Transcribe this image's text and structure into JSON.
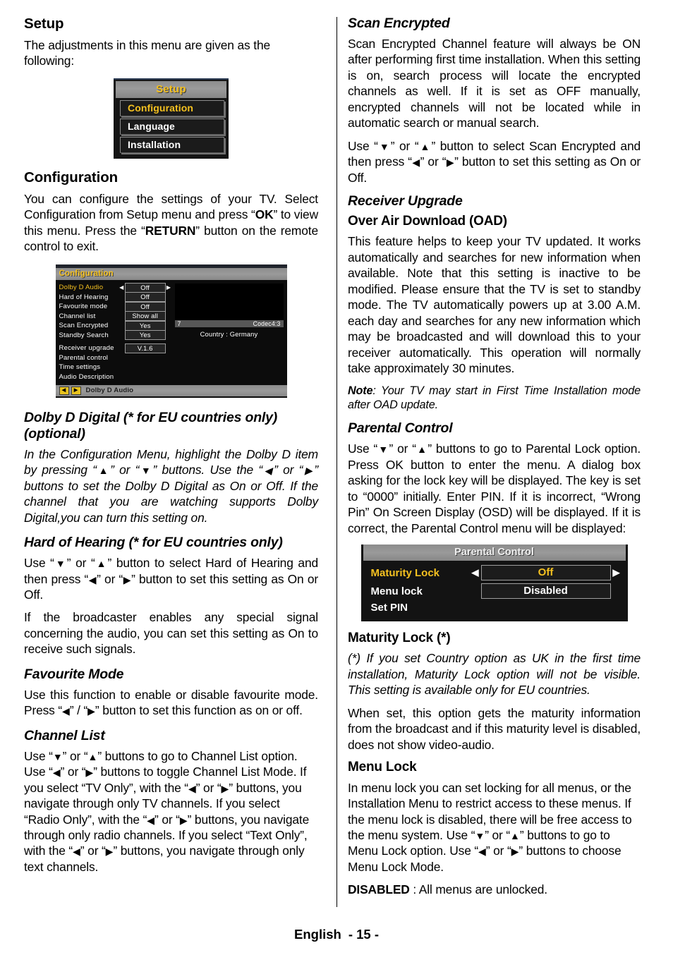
{
  "footer": {
    "language": "English",
    "page": "- 15 -"
  },
  "left": {
    "setup_heading": "Setup",
    "setup_intro": "The adjustments in this menu are given as the following:",
    "setup_osd": {
      "title": "Setup",
      "items": [
        {
          "label": "Configuration",
          "selected": true
        },
        {
          "label": "Language",
          "selected": false
        },
        {
          "label": "Installation",
          "selected": false
        }
      ]
    },
    "configuration_heading": "Configuration",
    "configuration_body_1": "You can configure the settings of your TV. Select Configuration from Setup menu and press “",
    "configuration_bold_ok": "OK",
    "configuration_body_2": "” to view this menu. Press the “",
    "configuration_bold_return": "RETURN",
    "configuration_body_3": "” button on the remote control to exit.",
    "config_osd": {
      "title": "Configuration",
      "rows": [
        {
          "label": "Dolby D Audio",
          "value": "Off",
          "selected": true,
          "carets": true
        },
        {
          "label": "Hard of Hearing",
          "value": "Off",
          "selected": false,
          "carets": false
        },
        {
          "label": "Favourite mode",
          "value": "Off",
          "selected": false,
          "carets": false
        },
        {
          "label": "Channel list",
          "value": "Show all",
          "selected": false,
          "carets": false
        },
        {
          "label": "Scan Encrypted",
          "value": "Yes",
          "selected": false,
          "carets": false
        },
        {
          "label": "Standby Search",
          "value": "Yes",
          "selected": false,
          "carets": false
        },
        {
          "label": "Receiver upgrade",
          "value": "V.1.6",
          "selected": false,
          "carets": false
        },
        {
          "label": "Parental control",
          "value": "",
          "selected": false,
          "carets": false
        },
        {
          "label": "Time settings",
          "value": "",
          "selected": false,
          "carets": false
        },
        {
          "label": "Audio Description",
          "value": "",
          "selected": false,
          "carets": false
        }
      ],
      "preview_bar_left": "7",
      "preview_bar_right": "Codec4:3",
      "country": "Country : Germany",
      "footer_left_key": "◀",
      "footer_right_key": "▶",
      "footer_text": "Dolby D Audio"
    },
    "dolby_heading": "Dolby D Digital (* for EU countries only) (optional)",
    "dolby_body_a": "In the Configuration Menu, highlight the Dolby D item by pressing “",
    "dolby_body_b": "” or “",
    "dolby_body_c": "” buttons. Use the “",
    "dolby_body_d": "” or “",
    "dolby_body_e": "” buttons to set the Dolby D Digital as On or Off. If the channel that you are watching supports Dolby Digital,you can turn this setting on.",
    "hoh_heading": "Hard of Hearing (* for EU countries only)",
    "hoh_body_a": "Use  “",
    "hoh_body_b": "” or “",
    "hoh_body_c": "” button to select Hard of Hearing and then press  “",
    "hoh_body_d": "” or “",
    "hoh_body_e": "” button to set this setting  as On or Off.",
    "hoh_body_2": "If the broadcaster enables any special signal concerning the audio, you can set this setting as On to receive such signals.",
    "fav_heading": "Favourite Mode",
    "fav_body_a": "Use this function to enable or disable favourite mode. Press “",
    "fav_body_b": "” / “",
    "fav_body_c": "” button to set this function as on or off.",
    "chlist_heading": "Channel List",
    "chlist_a": "Use “",
    "chlist_b": "” or “",
    "chlist_c": "” buttons to go to Channel List option. Use “",
    "chlist_d": "” or “",
    "chlist_e": "”  buttons to toggle Channel List Mode. If you select “TV Only”, with the “",
    "chlist_f": "” or “",
    "chlist_g": "”  buttons, you navigate through only TV channels. If you select “Radio Only”, with the “",
    "chlist_h": "” or “",
    "chlist_i": "”  buttons, you navigate through only radio channels.  If you select “Text Only”, with the “",
    "chlist_j": "” or “",
    "chlist_k": "”  buttons, you navigate through only text channels."
  },
  "right": {
    "scan_heading": "Scan Encrypted",
    "scan_body_1": "Scan Encrypted Channel feature will always be ON after performing first time installation. When this setting is on, search process will locate the encrypted channels as well. If it is set as OFF manually, encrypted channels will not be located while in automatic search or manual search.",
    "scan_body_2a": "Use “",
    "scan_body_2b": "” or “",
    "scan_body_2c": "” button to select Scan Encrypted and then press “",
    "scan_body_2d": "” or “",
    "scan_body_2e": "” button to set this setting as On or Off.",
    "receiver_heading": "Receiver Upgrade",
    "oad_heading": "Over Air Download (OAD)",
    "oad_body": "This feature helps to keep your TV updated. It works automatically and searches for new information when available. Note that this setting is inactive to be modified. Please ensure that the TV is set to standby mode. The TV automatically powers up at 3.00 A.M. each day and searches for any new information which may be broadcasted and will download this to your receiver automatically. This operation will normally take approximately 30 minutes.",
    "note_label": "Note",
    "note_body": ": Your TV may start in First Time Installation mode after OAD update.",
    "parental_heading": "Parental Control",
    "parental_a": "Use “",
    "parental_b": "” or “",
    "parental_c": "” buttons to go to Parental Lock option. Press OK button to enter the menu. A dialog box asking for the lock key will be displayed. The key is set to “0000” initially. Enter PIN. If it is incorrect, “Wrong Pin” On Screen Display (OSD) will be displayed. If it is correct, the Parental Control menu will be displayed:",
    "parental_osd": {
      "title": "Parental Control",
      "rows": [
        {
          "label": "Maturity Lock",
          "value": "Off",
          "selected": true,
          "carets": true
        },
        {
          "label": "Menu lock",
          "value": "Disabled",
          "selected": false,
          "carets": false
        },
        {
          "label": "Set PIN",
          "value": "",
          "selected": false,
          "carets": false
        }
      ]
    },
    "maturity_heading": "Maturity Lock (*)",
    "maturity_ital": "(*) If you set Country option as UK in the first time installation, Maturity Lock option will not be visible. This setting is available only for EU countries.",
    "maturity_body": "When set, this option gets the maturity information from the broadcast and if this maturity level is disabled, does not show video-audio.",
    "menulock_heading": "Menu Lock",
    "menulock_a": "In menu lock you can set locking for all menus, or the Installation Menu to restrict access to these menus. If the menu lock is disabled, there will be free access to the menu system. Use  “",
    "menulock_b": "” or “",
    "menulock_c": "” buttons to go to Menu Lock option. Use  “",
    "menulock_d": "” or “",
    "menulock_e": "” buttons to choose Menu Lock Mode.",
    "disabled_label": "DISABLED",
    "disabled_body": " : All menus are unlocked."
  },
  "glyphs": {
    "up": "▲",
    "down": "▼",
    "left": "◀",
    "right": "▶"
  }
}
